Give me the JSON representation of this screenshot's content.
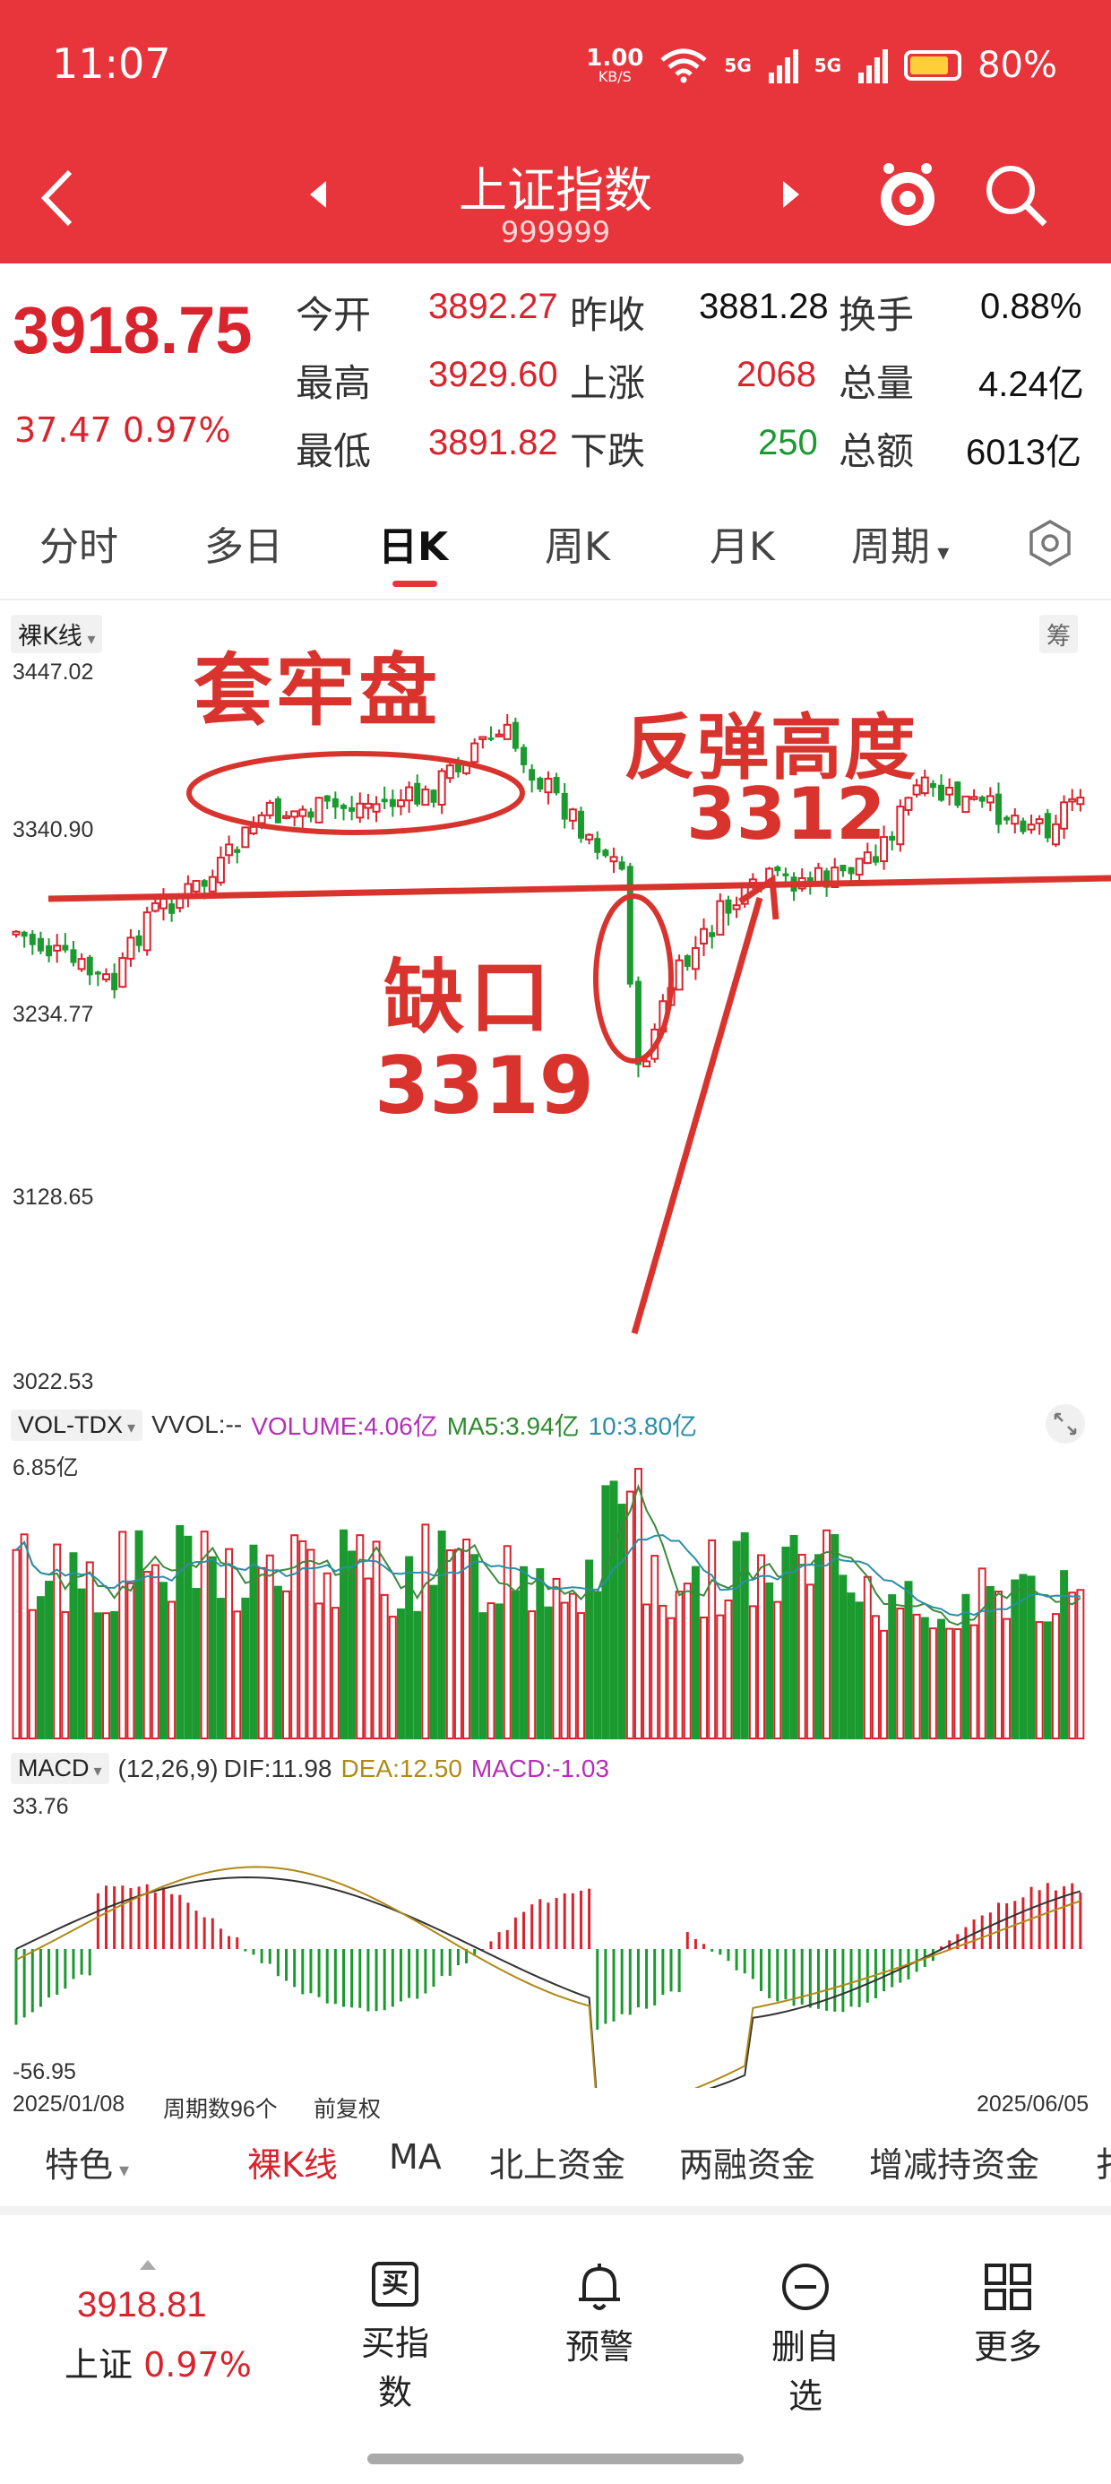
{
  "status": {
    "time": "11:07",
    "net_speed_top": "1.00",
    "net_speed_unit": "KB/S",
    "signal1": "5G",
    "signal2": "5G",
    "battery": "80%"
  },
  "nav": {
    "title": "上证指数",
    "code": "999999"
  },
  "quote": {
    "price": "3918.75",
    "change": "37.47",
    "change_pct": "0.97%",
    "open_label": "今开",
    "open": "3892.27",
    "prev_label": "昨收",
    "prev": "3881.28",
    "turnover_label": "换手",
    "turnover": "0.88%",
    "high_label": "最高",
    "high": "3929.60",
    "up_label": "上涨",
    "up": "2068",
    "volume_label": "总量",
    "volume": "4.24亿",
    "low_label": "最低",
    "low": "3891.82",
    "down_label": "下跌",
    "down": "250",
    "amount_label": "总额",
    "amount": "6013亿"
  },
  "tabs": [
    "分时",
    "多日",
    "日K",
    "周K",
    "月K",
    "周期"
  ],
  "kline": {
    "mode": "裸K线",
    "right_chip": "筹",
    "y_labels": [
      "3447.02",
      "3340.90",
      "3234.77",
      "3128.65",
      "3022.53"
    ]
  },
  "annotations": {
    "trapped": "套牢盘",
    "rebound": "反弹高度",
    "rebound_value": "3312",
    "gap": "缺口",
    "gap_value": "3319"
  },
  "vol": {
    "chip": "VOL-TDX",
    "vvol": "VVOL:--",
    "volume": "VOLUME:4.06亿",
    "ma5": "MA5:3.94亿",
    "ma10": "10:3.80亿",
    "ymax": "6.85亿"
  },
  "macd": {
    "chip": "MACD",
    "params": "(12,26,9)",
    "dif": "DIF:11.98",
    "dea": "DEA:12.50",
    "macd": "MACD:-1.03",
    "ymax": "33.76",
    "ymin": "-56.95"
  },
  "date_row": {
    "start": "2025/01/08",
    "period": "周期数96个",
    "adjust": "前复权",
    "end": "2025/06/05"
  },
  "bottom_tabs": [
    "特色",
    "裸K线",
    "MA",
    "北上资金",
    "两融资金",
    "增减持资金",
    "扌"
  ],
  "footer": {
    "price": "3918.81",
    "name": "上证",
    "pct": "0.97%",
    "buttons": [
      "买指数",
      "预警",
      "删自选",
      "更多"
    ],
    "buy_icon_text": "买"
  },
  "colors": {
    "brand": "#e8343b",
    "up": "#d9232d",
    "down": "#1a9a2f"
  }
}
